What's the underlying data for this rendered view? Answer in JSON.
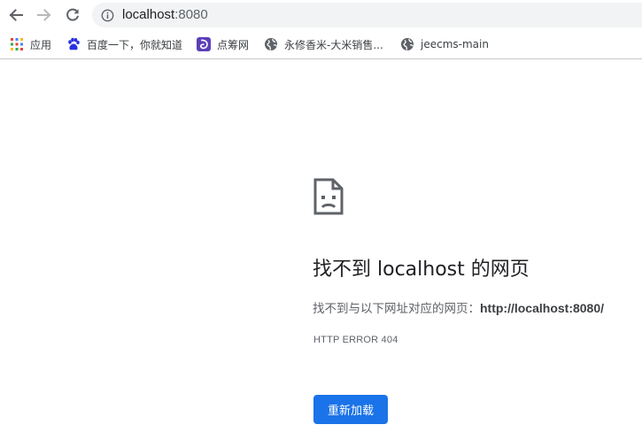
{
  "toolbar": {
    "back_icon": "arrow-left-icon",
    "forward_icon": "arrow-right-icon",
    "reload_icon": "reload-icon",
    "info_icon": "info-circle-icon",
    "url_host": "localhost",
    "url_port": ":8080"
  },
  "bookmarks": [
    {
      "label": "应用",
      "icon": "apps-grid-icon"
    },
    {
      "label": "百度一下，你就知道",
      "icon": "baidu-paw-icon"
    },
    {
      "label": "点筹网",
      "icon": "dianchou-logo-icon"
    },
    {
      "label": "永修香米-大米销售...",
      "icon": "globe-icon"
    },
    {
      "label": "jeecms-main",
      "icon": "globe-icon"
    }
  ],
  "error": {
    "icon": "sad-page-icon",
    "title": "找不到 localhost 的网页",
    "desc_prefix": "找不到与以下网址对应的网页：",
    "desc_url": "http://localhost:8080/",
    "code": "HTTP ERROR 404",
    "reload_label": "重新加载"
  },
  "colors": {
    "accent": "#1a73e8",
    "omnibox_bg": "#f1f3f4",
    "text_primary": "#202124",
    "text_secondary": "#5f6368"
  }
}
